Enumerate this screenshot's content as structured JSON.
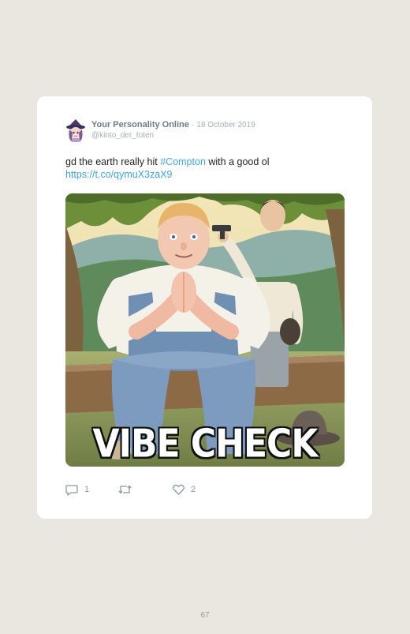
{
  "tweet": {
    "display_name": "Your Personality Online",
    "separator": "·",
    "date": "18 October 2019",
    "handle": "@kinto_der_toten",
    "text_before": "gd the earth really hit ",
    "hashtag": "#Compton",
    "text_after": " with a good ol",
    "link": "https://t.co/qymuX3zaX9",
    "image": {
      "caption": "VIBE CHECK"
    },
    "actions": {
      "reply_icon": "comment-bubble-icon",
      "reply_count": "1",
      "retweet_icon": "retweet-icon",
      "like_icon": "heart-icon",
      "like_count": "2"
    }
  },
  "page_number": "67",
  "colors": {
    "page_background": "#eae7e1",
    "card_background": "#ffffff",
    "link": "#46a3dc",
    "display_name": "#6e7b87",
    "meta": "#a6aeb5"
  }
}
